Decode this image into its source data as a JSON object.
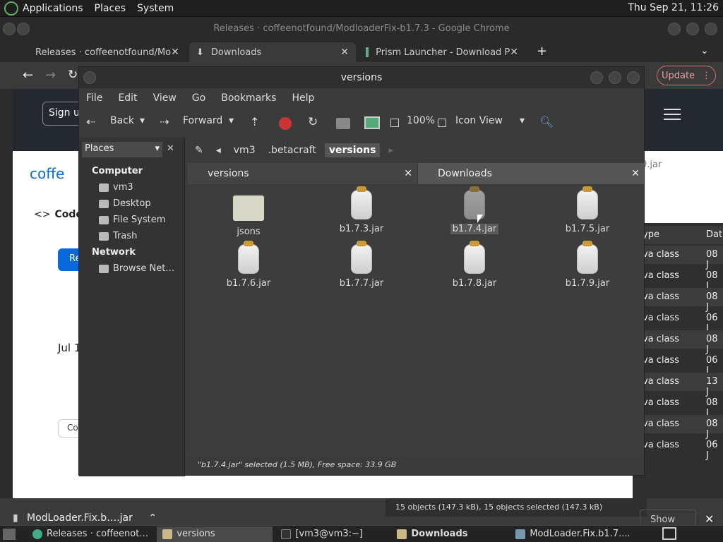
{
  "top_panel": {
    "menus": [
      "Applications",
      "Places",
      "System"
    ],
    "clock": "Thu Sep 21, 11:26"
  },
  "chrome": {
    "title": "Releases · coffeenotfound/ModloaderFix-b1.7.3 - Google Chrome",
    "tabs": [
      {
        "label": "Releases · coffeenotfound/Mo"
      },
      {
        "label": "Downloads"
      },
      {
        "label": "Prism Launcher - Download P"
      }
    ],
    "update_label": "Update"
  },
  "web": {
    "signup": "Sign up",
    "repo": "coffe",
    "code": "Code",
    "release_btn": "Re",
    "date": "Jul 1",
    "co_btn": "Co",
    "jar_label": "0.jar",
    "file_table": {
      "header": [
        "ype",
        "Dat"
      ],
      "rows": [
        {
          "type": "va class",
          "date": "08 J"
        },
        {
          "type": "va class",
          "date": "08 J"
        },
        {
          "type": "va class",
          "date": "08 J"
        },
        {
          "type": "va class",
          "date": "06 J"
        },
        {
          "type": "va class",
          "date": "08 J"
        },
        {
          "type": "va class",
          "date": "06 J"
        },
        {
          "type": "va class",
          "date": "13 J"
        },
        {
          "type": "va class",
          "date": "08 J"
        },
        {
          "type": "va class",
          "date": "08 J"
        },
        {
          "type": "va class",
          "date": "06 J"
        }
      ]
    }
  },
  "downloads_bar": {
    "item": "ModLoader.Fix.b….jar",
    "status": "15 objects (147.3 kB), 15 objects selected (147.3 kB)",
    "show_all": "Show all"
  },
  "nautilus": {
    "title": "versions",
    "menu": [
      "File",
      "Edit",
      "View",
      "Go",
      "Bookmarks",
      "Help"
    ],
    "toolbar": {
      "back": "Back",
      "forward": "Forward",
      "zoom": "100%",
      "view_mode": "Icon View"
    },
    "places_combo": "Places",
    "sidebar": {
      "computer_heading": "Computer",
      "computer_items": [
        "vm3",
        "Desktop",
        "File System",
        "Trash"
      ],
      "network_heading": "Network",
      "network_items": [
        "Browse Net…"
      ]
    },
    "breadcrumbs": [
      "vm3",
      ".betacraft",
      "versions"
    ],
    "pane_tabs": [
      "versions",
      "Downloads"
    ],
    "items": [
      {
        "name": "jsons",
        "kind": "folder"
      },
      {
        "name": "b1.7.3.jar",
        "kind": "jar"
      },
      {
        "name": "b1.7.4.jar",
        "kind": "jar",
        "selected": true
      },
      {
        "name": "b1.7.5.jar",
        "kind": "jar"
      },
      {
        "name": "b1.7.6.jar",
        "kind": "jar"
      },
      {
        "name": "b1.7.7.jar",
        "kind": "jar"
      },
      {
        "name": "b1.7.8.jar",
        "kind": "jar"
      },
      {
        "name": "b1.7.9.jar",
        "kind": "jar"
      }
    ],
    "status": "\"b1.7.4.jar\" selected (1.5 MB), Free space: 33.9 GB"
  },
  "taskbar": {
    "tasks": [
      {
        "label": "Releases · coffeenot…",
        "icon": "chrome-icon"
      },
      {
        "label": "versions",
        "icon": "folder-icon",
        "active": true
      },
      {
        "label": "[vm3@vm3:~]",
        "icon": "terminal-icon"
      },
      {
        "label": "Downloads",
        "icon": "folder-icon",
        "bold": true
      },
      {
        "label": "ModLoader.Fix.b1.7....",
        "icon": "archive-icon"
      }
    ]
  }
}
